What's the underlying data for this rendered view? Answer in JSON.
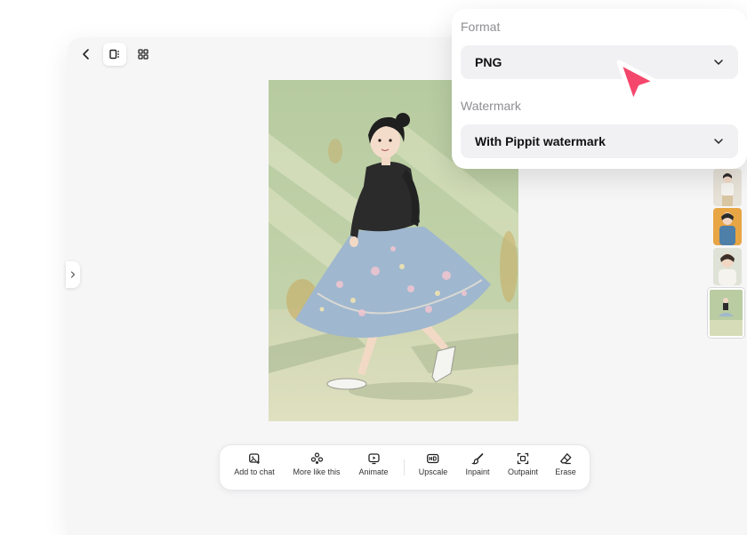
{
  "export_panel": {
    "format": {
      "label": "Format",
      "selected": "PNG"
    },
    "watermark": {
      "label": "Watermark",
      "selected": "With Pippit watermark"
    }
  },
  "toolbar": {
    "tools": [
      {
        "label": "Add to chat",
        "icon": "image-plus-icon"
      },
      {
        "label": "More like this",
        "icon": "sparkle-cluster-icon"
      },
      {
        "label": "Animate",
        "icon": "play-frame-icon"
      },
      {
        "label": "Upscale",
        "icon": "hd-icon"
      },
      {
        "label": "Inpaint",
        "icon": "brush-icon"
      },
      {
        "label": "Outpaint",
        "icon": "expand-frame-icon"
      },
      {
        "label": "Erase",
        "icon": "eraser-icon"
      }
    ]
  },
  "colors": {
    "accent_cursor": "#f4476b",
    "canvas_bg": "#f6f6f7",
    "panel_bg": "#ffffff",
    "select_bg": "#f1f1f3",
    "artwork_wall": "#b9cca2"
  }
}
